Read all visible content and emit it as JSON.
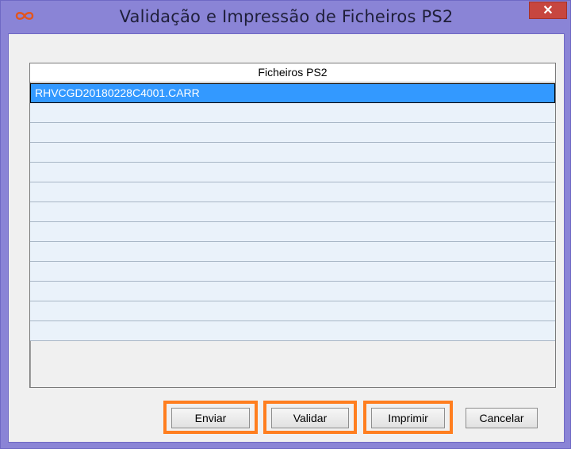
{
  "window": {
    "title": "Validação e Impressão de Ficheiros PS2",
    "close_glyph": "✕",
    "icon": "infinity-icon"
  },
  "list": {
    "header": "Ficheiros PS2",
    "rows": [
      "RHVCGD20180228C4001.CARR",
      "",
      "",
      "",
      "",
      "",
      "",
      "",
      "",
      "",
      "",
      "",
      ""
    ],
    "selected_index": 0
  },
  "buttons": {
    "enviar": "Enviar",
    "validar": "Validar",
    "imprimir": "Imprimir",
    "cancelar": "Cancelar"
  },
  "colors": {
    "title_bar": "#8a84d6",
    "close_button": "#c7463f",
    "selection": "#3399ff",
    "row_background": "#eaf2fa",
    "highlight_outline": "#ff7e1f"
  }
}
